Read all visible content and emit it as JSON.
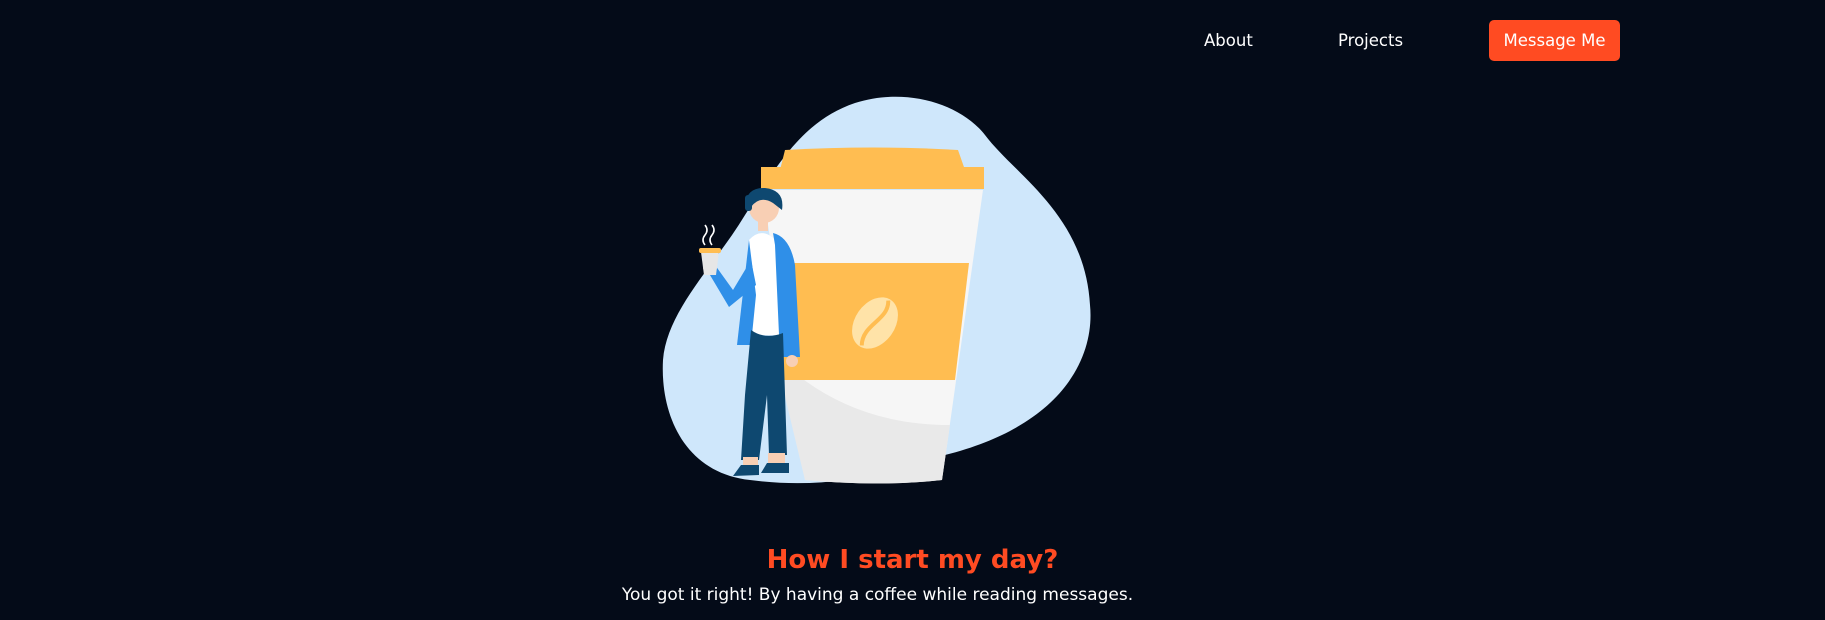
{
  "nav": {
    "about_label": "About",
    "projects_label": "Projects",
    "cta_label": "Message Me"
  },
  "hero": {
    "title": "How I start my day?",
    "subtitle": "You got it right! By having a coffee while reading messages."
  },
  "colors": {
    "background": "#040b18",
    "accent": "#ff4b22",
    "blob": "#cfe7fb",
    "cup_lid": "#ffbd51",
    "cup_body": "#f6f6f6",
    "jacket": "#2f8fe8",
    "pants": "#0e4870"
  },
  "icons": {
    "illustration": "person-with-giant-coffee-cup-illustration",
    "bean": "coffee-bean-icon"
  }
}
